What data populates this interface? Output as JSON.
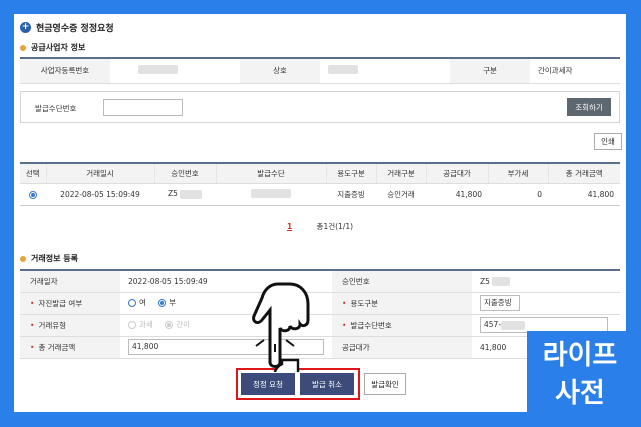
{
  "title": "현금영수증 정정요청",
  "supplier": {
    "section": "공급사업자 정보",
    "reg_no_label": "사업자등록번호",
    "name_label": "상호",
    "type_label": "구분",
    "type_value": "간이과세자"
  },
  "search": {
    "label": "발급수단번호",
    "value": "",
    "button": "조회하기"
  },
  "print_button": "인쇄",
  "list": {
    "columns": [
      "선택",
      "거래일시",
      "승인번호",
      "발급수단",
      "용도구분",
      "거래구분",
      "공급대가",
      "부가세",
      "총 거래금액"
    ],
    "rows": [
      {
        "datetime": "2022-08-05 15:09:49",
        "approval": "Z5",
        "means": "",
        "usage": "지출증빙",
        "deal": "승인거래",
        "supply": "41,800",
        "vat": "0",
        "total": "41,800"
      }
    ]
  },
  "pager": {
    "current": "1",
    "summary": "총1건(1/1)"
  },
  "register": {
    "section": "거래정보 등록",
    "date_label": "거래일자",
    "date_value": "2022-08-05 15:09:49",
    "approval_label": "승인번호",
    "approval_value": "Z5",
    "self_label": "자진발급 여부",
    "self_yes": "여",
    "self_no": "부",
    "usage_label": "용도구분",
    "usage_value": "지출증빙",
    "type_label": "거래유형",
    "type_tax": "과세",
    "type_simple": "간이",
    "means_label": "발급수단번호",
    "means_value": "457-",
    "total_label": "총 거래금액",
    "total_value": "41,800",
    "supply_label": "공급대가",
    "supply_value": "41,800"
  },
  "actions": {
    "correct": "정정 요청",
    "cancel": "발급 취소",
    "confirm": "발급확인"
  },
  "watermark": {
    "line1": "라이프",
    "line2": "사전"
  },
  "colors": {
    "background": "#2b7fe8",
    "accent": "#e0151a",
    "button": "#3c4b7a"
  }
}
